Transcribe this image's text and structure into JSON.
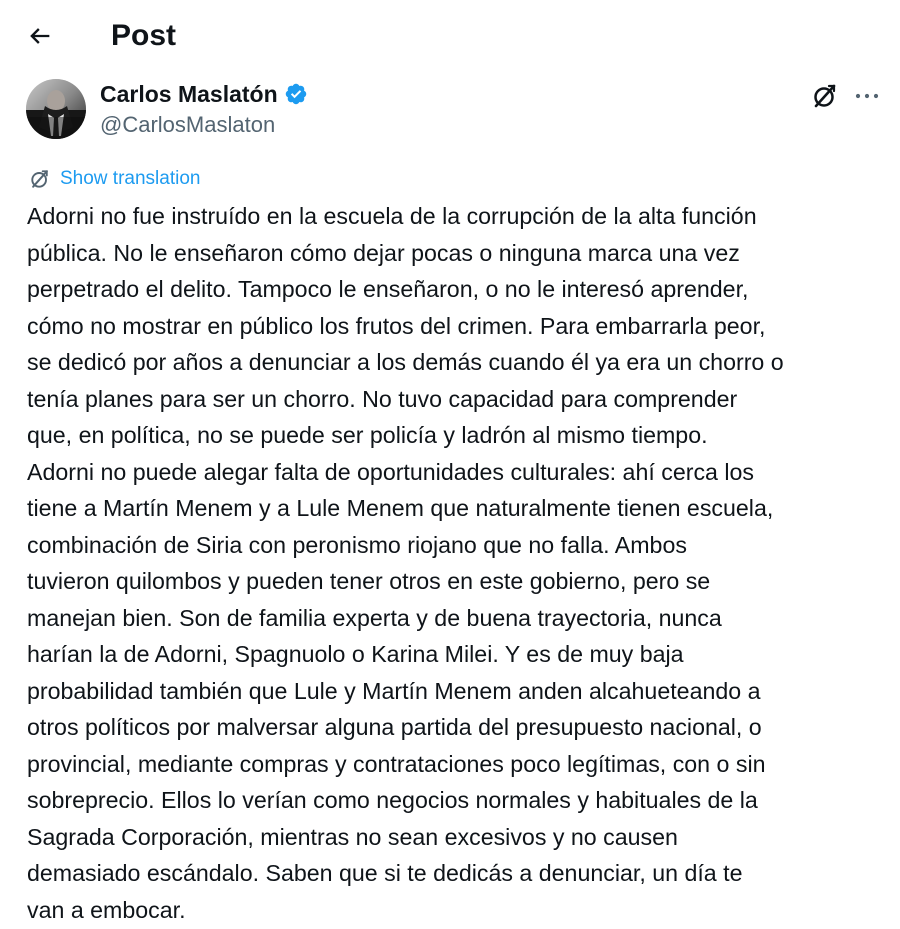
{
  "header": {
    "back_icon": "arrow-left-icon",
    "title": "Post"
  },
  "author": {
    "display_name": "Carlos Maslatón",
    "handle": "@CarlosMaslaton",
    "verified_icon": "verified-badge-icon",
    "verified_color": "#1d9bf0"
  },
  "actions": {
    "grok_icon": "grok-icon",
    "more_icon": "more-options-icon"
  },
  "translation": {
    "icon": "translate-icon",
    "label": "Show translation",
    "color": "#1d9bf0"
  },
  "tweet": {
    "lines": [
      "Adorni no fue instruído en la escuela de la corrupción de la alta función",
      "pública. No le enseñaron cómo dejar pocas o ninguna marca una vez",
      "perpetrado el delito. Tampoco le enseñaron, o no le interesó aprender,",
      "cómo no mostrar en público los frutos del crimen. Para embarrarla peor,",
      "se dedicó por años a denunciar a los demás cuando él ya era un chorro o",
      "tenía planes para ser un chorro. No tuvo capacidad para comprender",
      "que, en política, no se puede ser policía y ladrón al mismo tiempo.",
      "Adorni no puede alegar falta de oportunidades culturales: ahí cerca los",
      "tiene a Martín Menem y a Lule Menem que naturalmente tienen escuela,",
      "combinación de Siria con peronismo riojano que no falla. Ambos",
      "tuvieron quilombos y pueden tener otros en este gobierno, pero se",
      "manejan bien. Son de familia experta y de buena trayectoria, nunca",
      "harían la de Adorni, Spagnuolo o Karina Milei. Y es de muy baja",
      "probabilidad también que Lule y Martín Menem anden alcahueteando a",
      "otros políticos por malversar alguna partida del presupuesto nacional, o",
      "provincial, mediante compras y contrataciones poco legítimas, con o sin",
      "sobreprecio. Ellos lo verían como negocios normales y habituales de la",
      "Sagrada Corporación, mientras no sean excesivos y no causen",
      "demasiado escándalo. Saben que si te dedicás a denunciar, un día te",
      "van a embocar."
    ]
  },
  "colors": {
    "text_primary": "#0f1419",
    "text_secondary": "#536471",
    "background": "#ffffff",
    "accent": "#1d9bf0"
  }
}
